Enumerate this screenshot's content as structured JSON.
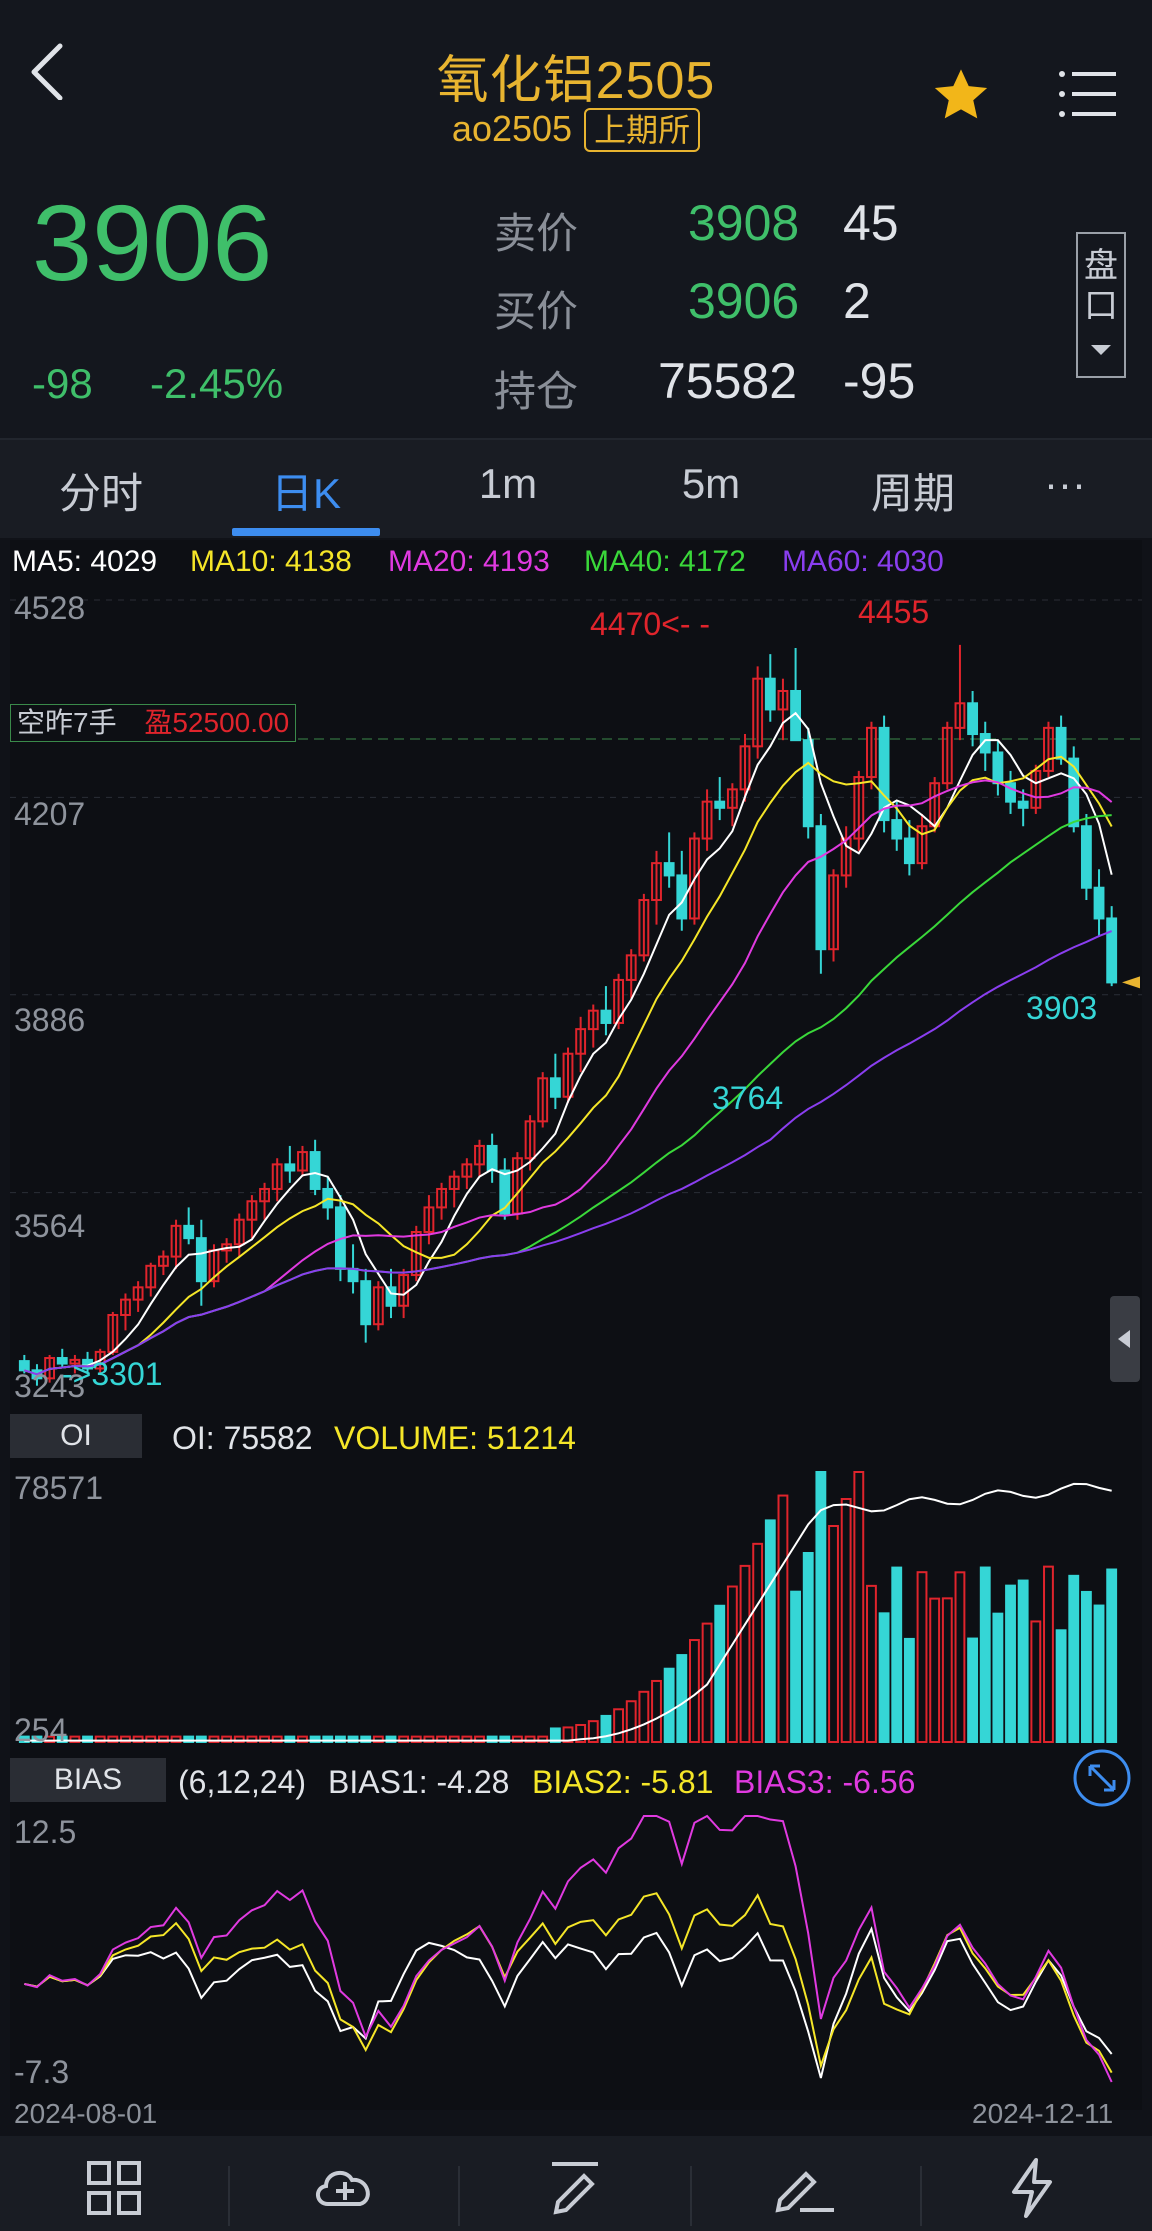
{
  "header": {
    "title": "氧化铝2505",
    "code": "ao2505",
    "exchange": "上期所",
    "back_icon": "chevron-left-icon",
    "star_icon": "star-icon",
    "menu_icon": "menu-icon"
  },
  "quote": {
    "last_price": "3906",
    "change": "-98",
    "change_pct": "-2.45%",
    "ask_label": "卖价",
    "ask_price": "3908",
    "ask_volume": "45",
    "bid_label": "买价",
    "bid_price": "3906",
    "bid_volume": "2",
    "oi_label": "持仓",
    "open_interest": "75582",
    "oi_change": "-95",
    "pankou_label": "盘口"
  },
  "tabs": [
    "分时",
    "日K",
    "1m",
    "5m",
    "周期",
    "···"
  ],
  "main_chart": {
    "ma_legend": [
      {
        "label": "MA5: 4029",
        "color": "#ffffff"
      },
      {
        "label": "MA10: 4138",
        "color": "#f5e628"
      },
      {
        "label": "MA20: 4193",
        "color": "#e03ae0"
      },
      {
        "label": "MA40: 4172",
        "color": "#3ad83a"
      },
      {
        "label": "MA60: 4030",
        "color": "#8a3ef0"
      }
    ],
    "y_ticks": [
      "4528",
      "4207",
      "3886",
      "3564",
      "3243"
    ],
    "position_label_a": "空昨7手",
    "position_label_b": "盈52500.00",
    "annotations": {
      "high1": "4470<- -",
      "high2": "4455",
      "low_mid": "3764",
      "last": "3903",
      "low_left": "->3301"
    }
  },
  "oi_panel": {
    "tag": "OI",
    "oi_text": "OI: 75582",
    "volume_text": "VOLUME: 51214",
    "y_max": "78571",
    "y_min": "254"
  },
  "bias_panel": {
    "tag": "BIAS",
    "params": "(6,12,24)",
    "bias1": "BIAS1: -4.28",
    "bias2": "BIAS2: -5.81",
    "bias3": "BIAS3: -6.56",
    "y_max": "12.5",
    "y_min": "-7.3",
    "date_start": "2024-08-01",
    "date_end": "2024-12-11"
  },
  "colors": {
    "up": "#e0242c",
    "down": "#35d6d6",
    "accent": "#3d8df0",
    "gold": "#e8b430"
  },
  "chart_data": {
    "type": "candlestick",
    "x_range": [
      "2024-08-01",
      "2024-12-11"
    ],
    "ylim": [
      3243,
      4528
    ],
    "ma": {
      "MA5": 4029,
      "MA10": 4138,
      "MA20": 4193,
      "MA40": 4172,
      "MA60": 4030
    },
    "candles_ohlc": [
      [
        3290,
        3300,
        3270,
        3275
      ],
      [
        3275,
        3285,
        3250,
        3262
      ],
      [
        3262,
        3300,
        3255,
        3295
      ],
      [
        3295,
        3310,
        3280,
        3286
      ],
      [
        3286,
        3300,
        3270,
        3292
      ],
      [
        3292,
        3305,
        3270,
        3278
      ],
      [
        3278,
        3310,
        3270,
        3305
      ],
      [
        3305,
        3370,
        3300,
        3365
      ],
      [
        3365,
        3400,
        3340,
        3390
      ],
      [
        3390,
        3420,
        3370,
        3410
      ],
      [
        3410,
        3450,
        3395,
        3445
      ],
      [
        3445,
        3470,
        3430,
        3460
      ],
      [
        3460,
        3520,
        3440,
        3510
      ],
      [
        3510,
        3540,
        3480,
        3490
      ],
      [
        3490,
        3520,
        3380,
        3420
      ],
      [
        3420,
        3480,
        3410,
        3470
      ],
      [
        3470,
        3490,
        3450,
        3480
      ],
      [
        3480,
        3530,
        3460,
        3520
      ],
      [
        3520,
        3560,
        3490,
        3550
      ],
      [
        3550,
        3580,
        3520,
        3570
      ],
      [
        3570,
        3620,
        3550,
        3610
      ],
      [
        3610,
        3640,
        3580,
        3600
      ],
      [
        3600,
        3640,
        3590,
        3630
      ],
      [
        3630,
        3650,
        3560,
        3570
      ],
      [
        3570,
        3590,
        3520,
        3540
      ],
      [
        3540,
        3560,
        3420,
        3440
      ],
      [
        3440,
        3480,
        3400,
        3420
      ],
      [
        3420,
        3440,
        3320,
        3350
      ],
      [
        3350,
        3420,
        3340,
        3410
      ],
      [
        3410,
        3440,
        3360,
        3380
      ],
      [
        3380,
        3440,
        3360,
        3430
      ],
      [
        3430,
        3510,
        3420,
        3500
      ],
      [
        3500,
        3560,
        3480,
        3540
      ],
      [
        3540,
        3580,
        3520,
        3570
      ],
      [
        3570,
        3600,
        3540,
        3590
      ],
      [
        3590,
        3620,
        3570,
        3610
      ],
      [
        3610,
        3650,
        3590,
        3640
      ],
      [
        3640,
        3660,
        3580,
        3600
      ],
      [
        3600,
        3620,
        3520,
        3530
      ],
      [
        3530,
        3630,
        3520,
        3620
      ],
      [
        3620,
        3690,
        3600,
        3680
      ],
      [
        3680,
        3760,
        3670,
        3750
      ],
      [
        3750,
        3790,
        3700,
        3720
      ],
      [
        3720,
        3800,
        3710,
        3790
      ],
      [
        3790,
        3850,
        3760,
        3830
      ],
      [
        3830,
        3870,
        3800,
        3860
      ],
      [
        3860,
        3900,
        3820,
        3840
      ],
      [
        3840,
        3920,
        3830,
        3910
      ],
      [
        3910,
        3960,
        3880,
        3950
      ],
      [
        3950,
        4050,
        3940,
        4040
      ],
      [
        4040,
        4120,
        4000,
        4100
      ],
      [
        4100,
        4150,
        4060,
        4080
      ],
      [
        4080,
        4120,
        3990,
        4010
      ],
      [
        4010,
        4150,
        4000,
        4140
      ],
      [
        4140,
        4220,
        4120,
        4200
      ],
      [
        4200,
        4240,
        4170,
        4190
      ],
      [
        4190,
        4230,
        4160,
        4220
      ],
      [
        4220,
        4310,
        4200,
        4290
      ],
      [
        4290,
        4420,
        4270,
        4400
      ],
      [
        4400,
        4440,
        4330,
        4350
      ],
      [
        4350,
        4400,
        4300,
        4380
      ],
      [
        4380,
        4450,
        4340,
        4300
      ],
      [
        4300,
        4320,
        4140,
        4160
      ],
      [
        4160,
        4180,
        3920,
        3960
      ],
      [
        3960,
        4090,
        3940,
        4080
      ],
      [
        4080,
        4160,
        4060,
        4140
      ],
      [
        4140,
        4250,
        4120,
        4240
      ],
      [
        4240,
        4330,
        4220,
        4320
      ],
      [
        4320,
        4340,
        4150,
        4170
      ],
      [
        4170,
        4200,
        4120,
        4140
      ],
      [
        4140,
        4170,
        4080,
        4100
      ],
      [
        4100,
        4180,
        4090,
        4160
      ],
      [
        4160,
        4240,
        4150,
        4230
      ],
      [
        4230,
        4330,
        4220,
        4320
      ],
      [
        4320,
        4455,
        4300,
        4360
      ],
      [
        4360,
        4380,
        4290,
        4310
      ],
      [
        4310,
        4330,
        4250,
        4280
      ],
      [
        4280,
        4300,
        4210,
        4230
      ],
      [
        4230,
        4250,
        4180,
        4200
      ],
      [
        4200,
        4220,
        4160,
        4190
      ],
      [
        4190,
        4260,
        4180,
        4250
      ],
      [
        4250,
        4330,
        4240,
        4320
      ],
      [
        4320,
        4340,
        4260,
        4270
      ],
      [
        4270,
        4290,
        4150,
        4160
      ],
      [
        4160,
        4180,
        4040,
        4060
      ],
      [
        4060,
        4090,
        3980,
        4010
      ],
      [
        4010,
        4030,
        3900,
        3906
      ]
    ],
    "oi_series_max": 78571,
    "oi_series_min": 254,
    "bias_range": [
      -7.3,
      12.5
    ]
  }
}
